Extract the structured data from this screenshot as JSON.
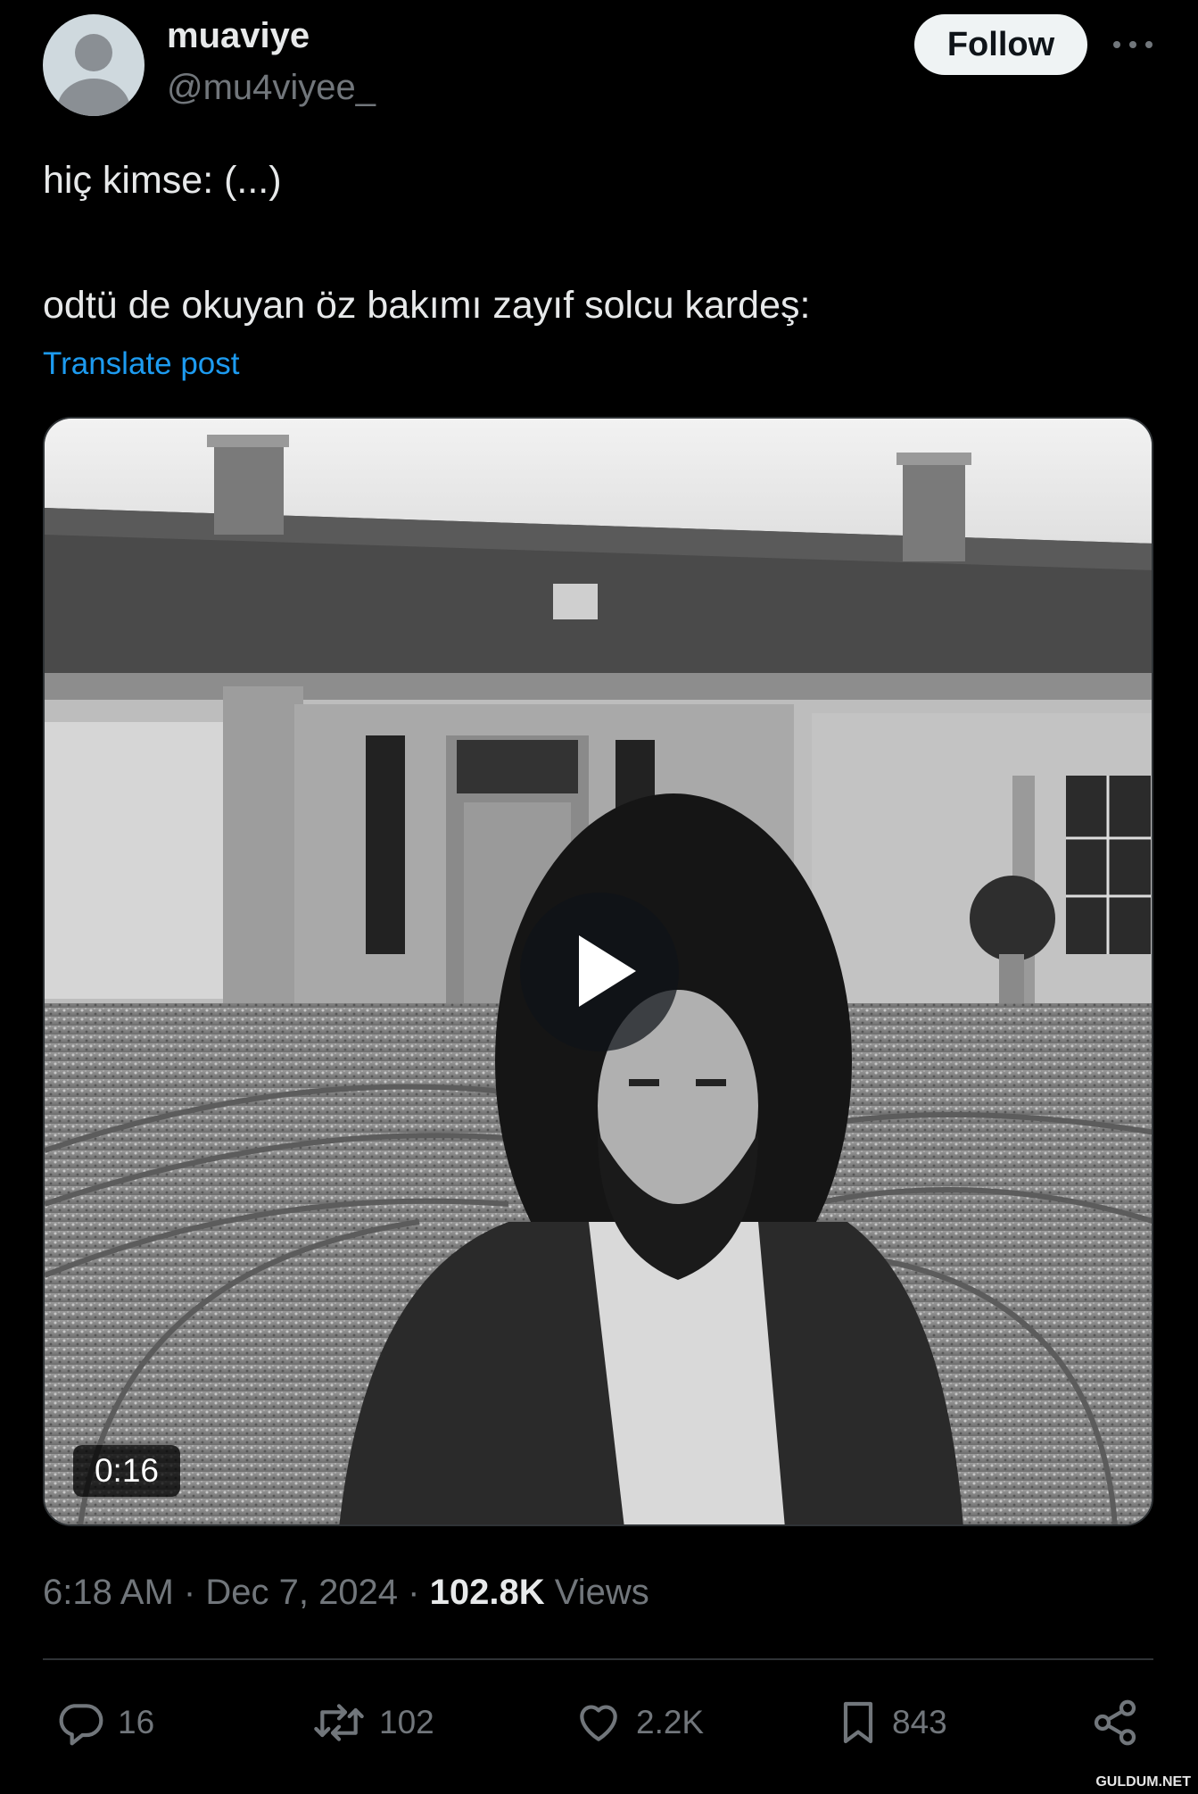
{
  "author": {
    "display_name": "muaviye",
    "handle": "@mu4viyee_",
    "follow_label": "Follow"
  },
  "tweet": {
    "line1": "hiç kimse: (...)",
    "line2": "odtü de okuyan öz bakımı zayıf solcu kardeş:",
    "translate_label": "Translate post"
  },
  "media": {
    "type": "video",
    "duration": "0:16",
    "play_icon": "play-icon"
  },
  "meta": {
    "time": "6:18 AM",
    "date": "Dec 7, 2024",
    "views_count": "102.8K",
    "views_label": "Views",
    "separator": "·"
  },
  "actions": {
    "replies": "16",
    "reposts": "102",
    "likes": "2.2K",
    "bookmarks": "843"
  },
  "icons": {
    "reply": "reply-icon",
    "repost": "repost-icon",
    "like": "heart-icon",
    "bookmark": "bookmark-icon",
    "share": "share-icon",
    "more": "more-icon"
  },
  "colors": {
    "background": "#000000",
    "text": "#e7e9ea",
    "muted": "#71767b",
    "link": "#1d9bf0",
    "follow_bg": "#eff3f4"
  },
  "watermark": "GULDUM.NET"
}
